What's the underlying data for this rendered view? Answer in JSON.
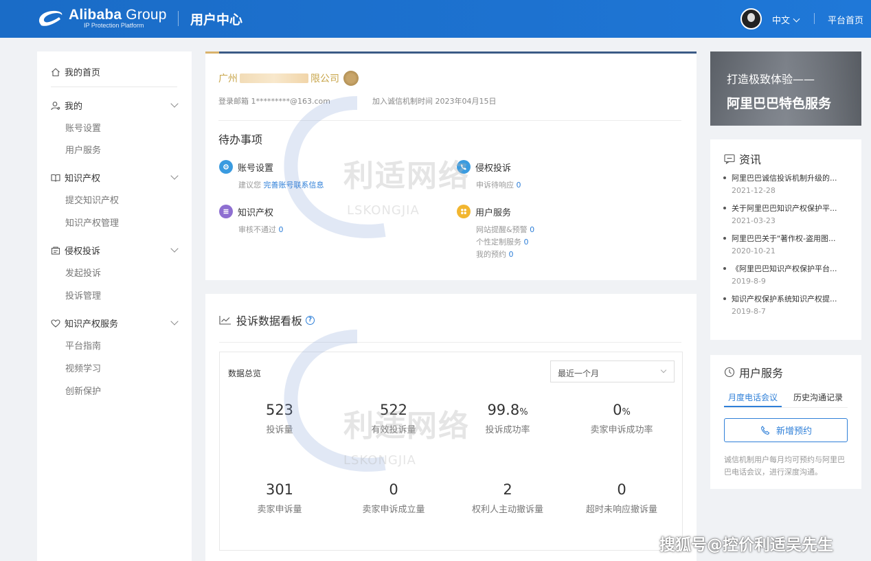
{
  "header": {
    "brand": "Alibaba",
    "brand_group": " Group",
    "brand_sub": "IP Protection Platform",
    "title": "用户中心",
    "language": "中文",
    "home_link": "平台首页"
  },
  "sidebar": {
    "home": "我的首页",
    "groups": [
      {
        "label": "我的",
        "icon": "user-icon",
        "items": [
          "账号设置",
          "用户服务"
        ]
      },
      {
        "label": "知识产权",
        "icon": "book-icon",
        "items": [
          "提交知识产权",
          "知识产权管理"
        ]
      },
      {
        "label": "侵权投诉",
        "icon": "complaint-icon",
        "items": [
          "发起投诉",
          "投诉管理"
        ]
      },
      {
        "label": "知识产权服务",
        "icon": "heart-icon",
        "items": [
          "平台指南",
          "视频学习",
          "创新保护"
        ]
      }
    ]
  },
  "account": {
    "company_prefix": "广州",
    "company_suffix": "限公司",
    "email_label": "登录邮箱",
    "email": "1*********@163.com",
    "join_label": "加入诚信机制时间",
    "join_date": "2023年04月15日"
  },
  "todo": {
    "title": "待办事项",
    "items": [
      {
        "label": "账号设置",
        "icon": "gear-icon",
        "color": "#3a9be0",
        "lines": [
          {
            "text": "建议您 ",
            "link": "完善账号联系信息"
          }
        ]
      },
      {
        "label": "侵权投诉",
        "icon": "phone-icon",
        "color": "#3a9be0",
        "lines": [
          {
            "text": "申诉待响应 ",
            "count": "0"
          }
        ]
      },
      {
        "label": "知识产权",
        "icon": "list-icon",
        "color": "#8e6fd1",
        "lines": [
          {
            "text": "审核不通过 ",
            "count": "0"
          }
        ]
      },
      {
        "label": "用户服务",
        "icon": "grid-icon",
        "color": "#f2b630",
        "lines": [
          {
            "text": "网站提醒&预警 ",
            "count": "0"
          },
          {
            "text": "个性定制服务 ",
            "count": "0"
          },
          {
            "text": "我的预约 ",
            "count": "0"
          }
        ]
      }
    ]
  },
  "dashboard": {
    "title": "投诉数据看板",
    "overview_label": "数据总览",
    "period": "最近一个月",
    "stats": [
      {
        "value": "523",
        "unit": "",
        "label": "投诉量"
      },
      {
        "value": "522",
        "unit": "",
        "label": "有效投诉量"
      },
      {
        "value": "99.8",
        "unit": "%",
        "label": "投诉成功率"
      },
      {
        "value": "0",
        "unit": "%",
        "label": "卖家申诉成功率"
      },
      {
        "value": "301",
        "unit": "",
        "label": "卖家申诉量"
      },
      {
        "value": "0",
        "unit": "",
        "label": "卖家申诉成立量"
      },
      {
        "value": "2",
        "unit": "",
        "label": "权利人主动撤诉量"
      },
      {
        "value": "0",
        "unit": "",
        "label": "超时未响应撤诉量"
      }
    ]
  },
  "banner": {
    "line1": "打造极致体验——",
    "line2": "阿里巴巴特色服务"
  },
  "news": {
    "title": "资讯",
    "items": [
      {
        "title": "阿里巴巴诚信投诉机制升级的...",
        "date": "2021-12-28"
      },
      {
        "title": "关于阿里巴巴知识产权保护平...",
        "date": "2021-03-23"
      },
      {
        "title": "阿里巴巴关于\"著作权-盗用图...",
        "date": "2020-10-21"
      },
      {
        "title": "《阿里巴巴知识产权保护平台...",
        "date": "2019-8-9"
      },
      {
        "title": "知识产权保护系统知识产权提...",
        "date": "2019-8-7"
      }
    ]
  },
  "service": {
    "title": "用户服务",
    "tab_active": "月度电话会议",
    "tab_other": "历史沟通记录",
    "button": "新增预约",
    "description": "诚信机制用户每月均可预约与阿里巴巴电话会议，进行深度沟通。"
  },
  "watermark": {
    "text": "利适网络",
    "sub": "LSKONGJIA",
    "corner": "搜狐号@控价利适吴先生"
  }
}
